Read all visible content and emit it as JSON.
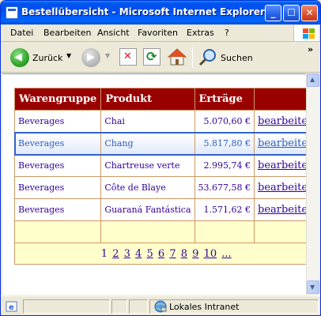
{
  "window": {
    "title": "Bestellübersicht - Microsoft Internet Explorer"
  },
  "menu": {
    "items": [
      {
        "label": "Datei"
      },
      {
        "label": "Bearbeiten"
      },
      {
        "label": "Ansicht"
      },
      {
        "label": "Favoriten"
      },
      {
        "label": "Extras"
      },
      {
        "label": "?"
      }
    ]
  },
  "toolbar": {
    "back_label": "Zurück",
    "search_label": "Suchen",
    "chevron": "»"
  },
  "grid": {
    "headers": [
      "Warengruppe",
      "Produkt",
      "Erträge",
      ""
    ],
    "rows": [
      {
        "group": "Beverages",
        "product": "Chai",
        "revenue": "5.070,60 €",
        "action": "bearbeiten"
      },
      {
        "group": "Beverages",
        "product": "Chang",
        "revenue": "5.817,80 €",
        "action": "bearbeiten"
      },
      {
        "group": "Beverages",
        "product": "Chartreuse verte",
        "revenue": "2.995,74 €",
        "action": "bearbeiten"
      },
      {
        "group": "Beverages",
        "product": "Côte de Blaye",
        "revenue": "53.677,58 €",
        "action": "bearbeiten"
      },
      {
        "group": "Beverages",
        "product": "Guaraná Fantástica",
        "revenue": "1.571,62 €",
        "action": "bearbeiten"
      }
    ],
    "selected_row": 1,
    "pager": {
      "current": "1",
      "pages": [
        "2",
        "3",
        "4",
        "5",
        "6",
        "7",
        "8",
        "9",
        "10",
        "..."
      ]
    }
  },
  "status": {
    "zone": "Lokales Intranet"
  },
  "colors": {
    "header_bg": "#990000",
    "header_text": "#ffffff",
    "row_text": "#330099",
    "grid_border": "#cc9966",
    "footer_bg": "#ffffcc",
    "selected_border": "#3163c5"
  }
}
